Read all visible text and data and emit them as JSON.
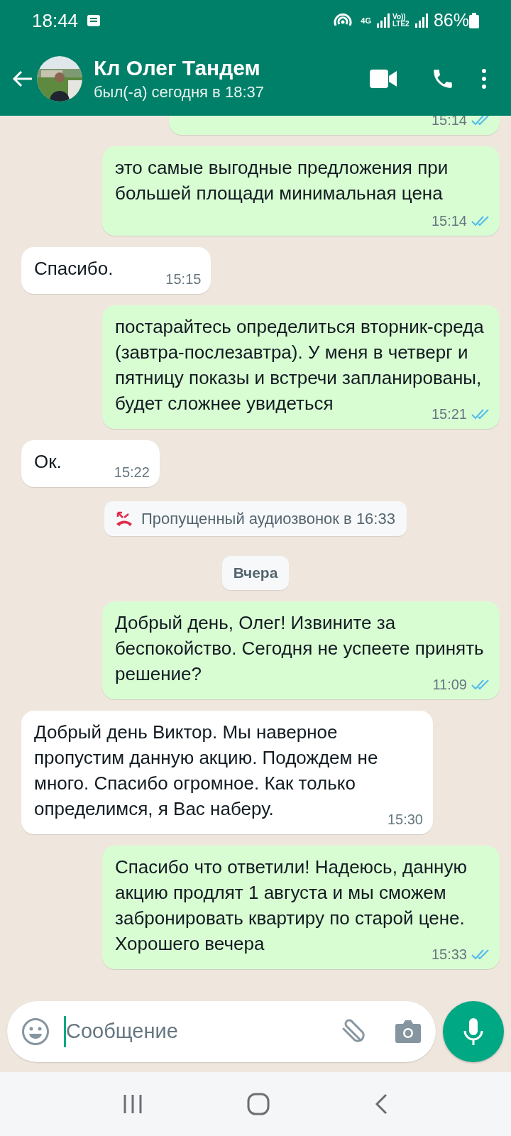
{
  "status_bar": {
    "time": "18:44",
    "network": "4G",
    "volte": "Vo)) LTE2",
    "battery": "86%"
  },
  "header": {
    "name": "Кл Олег Тандем",
    "last_seen": "был(-а) сегодня в 18:37"
  },
  "messages": [
    {
      "kind": "outgoing",
      "time": "15:14",
      "read": true,
      "cut": true
    },
    {
      "kind": "outgoing",
      "text": "это самые выгодные предложения при большей площади минимальная цена",
      "time": "15:14",
      "read": true
    },
    {
      "kind": "incoming",
      "text": "Спасибо.",
      "time": "15:15"
    },
    {
      "kind": "outgoing",
      "text": "постарайтесь определиться вторник-среда (завтра-послезавтра). У меня в четверг и пятницу показы и встречи запланированы, будет сложнее увидеться",
      "time": "15:21",
      "read": true
    },
    {
      "kind": "incoming",
      "text": "Ок.",
      "time": "15:22"
    },
    {
      "kind": "missed_call",
      "text": "Пропущенный аудиозвонок в 16:33"
    },
    {
      "kind": "date",
      "text": "Вчера"
    },
    {
      "kind": "outgoing",
      "text": "Добрый день, Олег! Извините за беспокойство. Сегодня не успеете принять решение?",
      "time": "11:09",
      "read": true
    },
    {
      "kind": "incoming",
      "text": "Добрый день Виктор. Мы наверное пропустим данную акцию. Подождем не много. Спасибо огромное. Как только определимся, я Вас наберу.",
      "time": "15:30"
    },
    {
      "kind": "outgoing",
      "text": "Спасибо что ответили! Надеюсь, данную акцию продлят 1 августа и мы сможем забронировать квартиру по старой цене. Хорошего вечера",
      "time": "15:33",
      "read": true
    }
  ],
  "composer": {
    "placeholder": "Сообщение"
  }
}
